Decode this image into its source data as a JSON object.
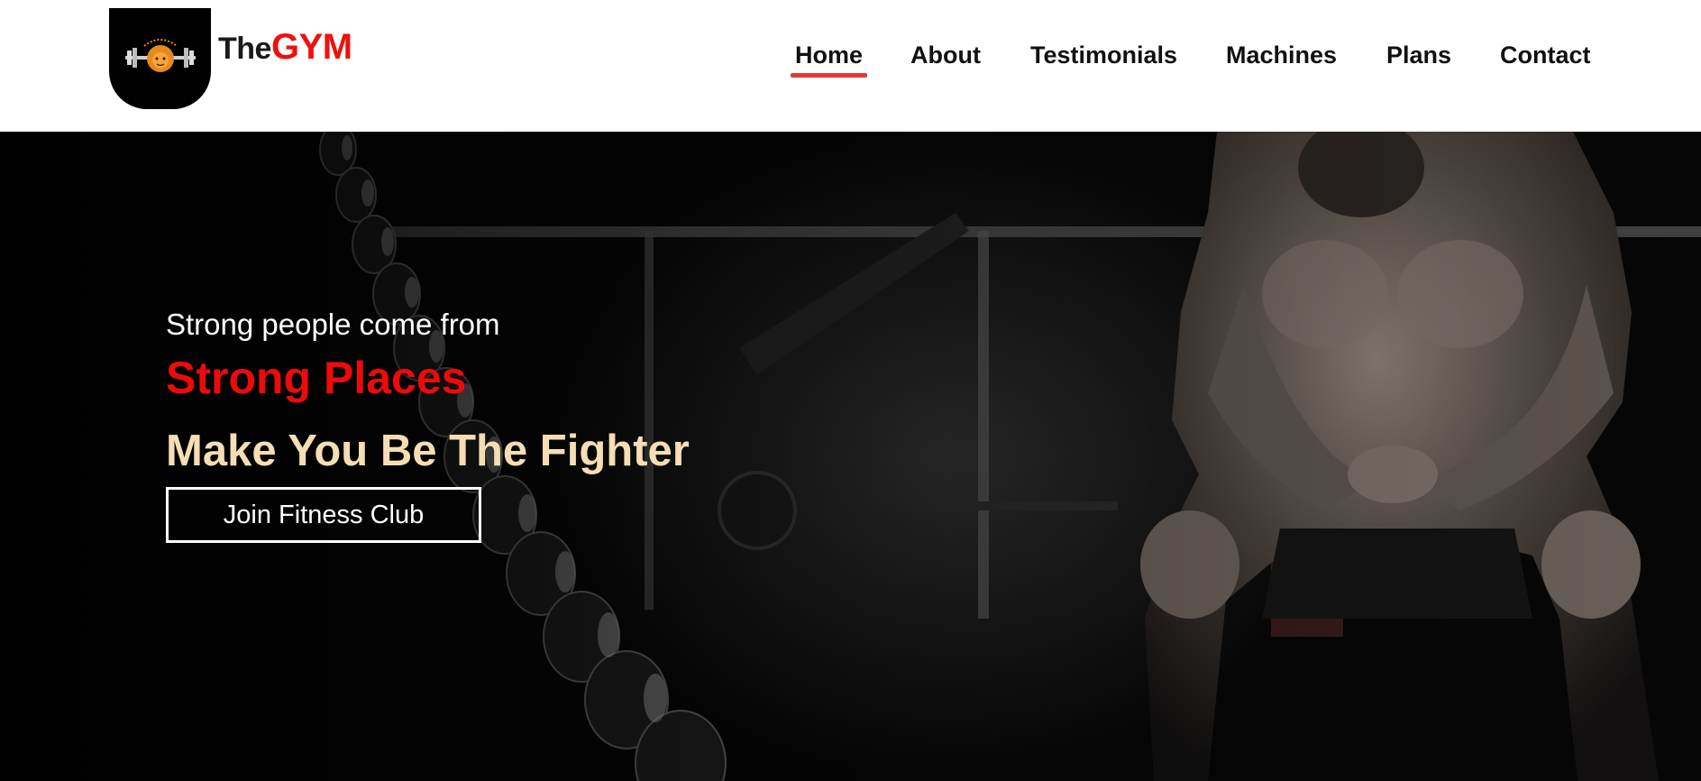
{
  "brand": {
    "prefix": "The",
    "name": "GYM",
    "logo_icon": "gym-lion-barbell-logo",
    "accent_color": "#ee1111"
  },
  "nav": {
    "items": [
      {
        "label": "Home",
        "active": true
      },
      {
        "label": "About",
        "active": false
      },
      {
        "label": "Testimonials",
        "active": false
      },
      {
        "label": "Machines",
        "active": false
      },
      {
        "label": "Plans",
        "active": false
      },
      {
        "label": "Contact",
        "active": false
      }
    ],
    "active_underline_color": "#e53935"
  },
  "hero": {
    "line1": "Strong people come from",
    "line2": "Strong Places",
    "line3": "Make You Be The Fighter",
    "cta_label": "Join Fitness Club",
    "colors": {
      "line1": "#ffffff",
      "line2": "#ee0a0a",
      "line3": "#f5deb3"
    },
    "background_image": "gym-athlete-dumbbell-rack-photo"
  }
}
